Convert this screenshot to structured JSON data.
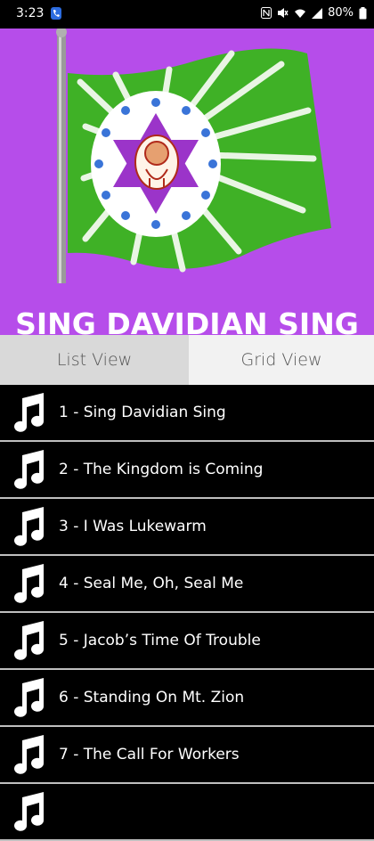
{
  "status_bar": {
    "time": "3:23",
    "battery": "80%",
    "icons": [
      "phone-icon",
      "nfc-icon",
      "mute-icon",
      "wifi-icon",
      "signal-icon",
      "battery-icon"
    ]
  },
  "banner": {
    "title": "SING DAVIDIAN SING",
    "background": "#b64dea"
  },
  "tabs": [
    {
      "label": "List View",
      "active": true
    },
    {
      "label": "Grid View",
      "active": false
    }
  ],
  "songs": [
    {
      "label": "1 - Sing Davidian Sing"
    },
    {
      "label": "2 - The Kingdom is Coming"
    },
    {
      "label": "3 - I Was Lukewarm"
    },
    {
      "label": "4 - Seal Me, Oh, Seal Me"
    },
    {
      "label": "5 - Jacob’s Time Of Trouble"
    },
    {
      "label": "6 - Standing On Mt. Zion"
    },
    {
      "label": "7 - The Call For Workers"
    },
    {
      "label": ""
    }
  ]
}
